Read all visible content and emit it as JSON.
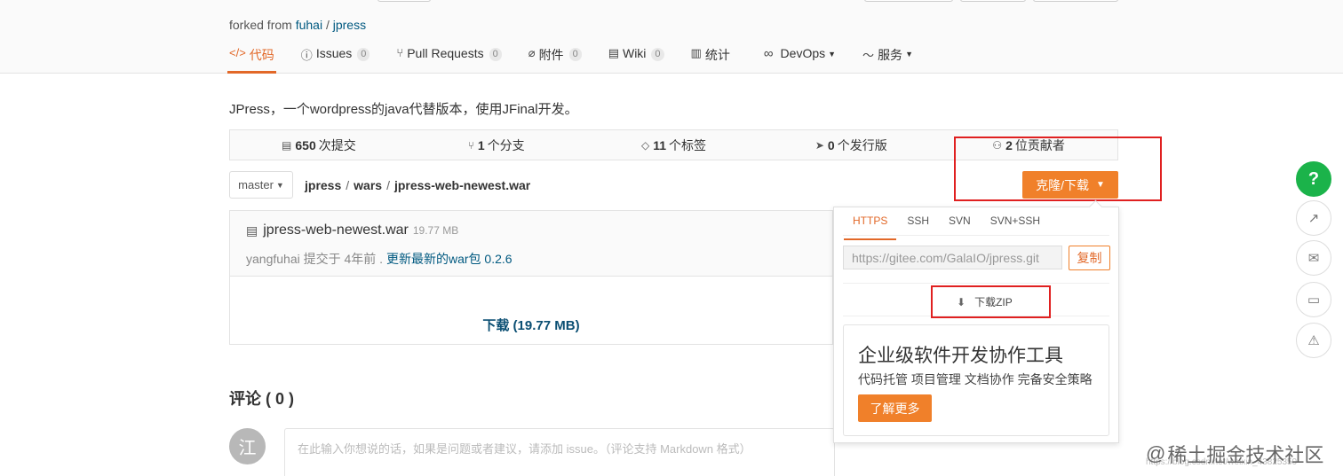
{
  "header": {
    "forked_prefix": "forked from",
    "fork_user": "fuhai",
    "fork_sep": "/",
    "fork_repo": "jpress",
    "tabs": [
      {
        "icon": "code-icon",
        "glyph": "</>",
        "label": "代码",
        "count": "",
        "active": true
      },
      {
        "icon": "issue-icon",
        "glyph": "ⓘ",
        "label": "Issues",
        "count": "0",
        "active": false
      },
      {
        "icon": "pull-request-icon",
        "glyph": "⑂",
        "label": "Pull Requests",
        "count": "0",
        "active": false
      },
      {
        "icon": "attachment-icon",
        "glyph": "⌀",
        "label": "附件",
        "count": "0",
        "active": false
      },
      {
        "icon": "wiki-icon",
        "glyph": "▤",
        "label": "Wiki",
        "count": "0",
        "active": false
      },
      {
        "icon": "stats-icon",
        "glyph": "▥",
        "label": "统计",
        "count": "",
        "active": false
      },
      {
        "icon": "devops-icon",
        "glyph": "∞",
        "label": "DevOps",
        "count": "",
        "active": false,
        "dropdown": true
      },
      {
        "icon": "service-icon",
        "glyph": "〜",
        "label": "服务",
        "count": "",
        "active": false,
        "dropdown": true
      }
    ]
  },
  "repo": {
    "description": "JPress，一个wordpress的java代替版本，使用JFinal开发。",
    "stats": [
      {
        "icon": "commit-icon",
        "glyph": "▤",
        "num": "650",
        "label": "次提交"
      },
      {
        "icon": "branch-icon",
        "glyph": "⑂",
        "num": "1",
        "label": "个分支"
      },
      {
        "icon": "tag-icon",
        "glyph": "◇",
        "num": "11",
        "label": "个标签"
      },
      {
        "icon": "release-icon",
        "glyph": "➤",
        "num": "0",
        "label": "个发行版"
      },
      {
        "icon": "contributors-icon",
        "glyph": "⚇",
        "num": "2",
        "label": "位贡献者"
      }
    ],
    "branch": "master",
    "breadcrumb": [
      "jpress",
      "wars",
      "jpress-web-newest.war"
    ],
    "clone_label": "克隆/下载"
  },
  "file": {
    "name": "jpress-web-newest.war",
    "size": "19.77 MB",
    "commit_author": "yangfuhai",
    "commit_text": "提交于 4年前 .",
    "commit_message": "更新最新的war包 0.2.6",
    "download_label": "下载 (19.77 MB)"
  },
  "comments": {
    "title": "评论 ( 0 )",
    "avatar_char": "江",
    "placeholder": "在此输入你想说的话，如果是问题或者建议，请添加 issue。（评论支持 Markdown 格式）"
  },
  "clone_panel": {
    "tabs": [
      "HTTPS",
      "SSH",
      "SVN",
      "SVN+SSH"
    ],
    "active_tab": "HTTPS",
    "url": "https://gitee.com/GalaIO/jpress.git",
    "copy_label": "复制",
    "zip_label": "下载ZIP",
    "ad_title": "企业级软件开发协作工具",
    "ad_sub": "代码托管 项目管理 文档协作 完备安全策略",
    "ad_button": "了解更多"
  },
  "watermark": {
    "text": "稀土掘金技术社区",
    "url": "https://blog.csdn.net/weixin_43825350"
  },
  "colors": {
    "accent": "#e26828",
    "button": "#f0802a",
    "link": "#005980",
    "help": "#1bb34a",
    "annotation": "#e02020"
  }
}
